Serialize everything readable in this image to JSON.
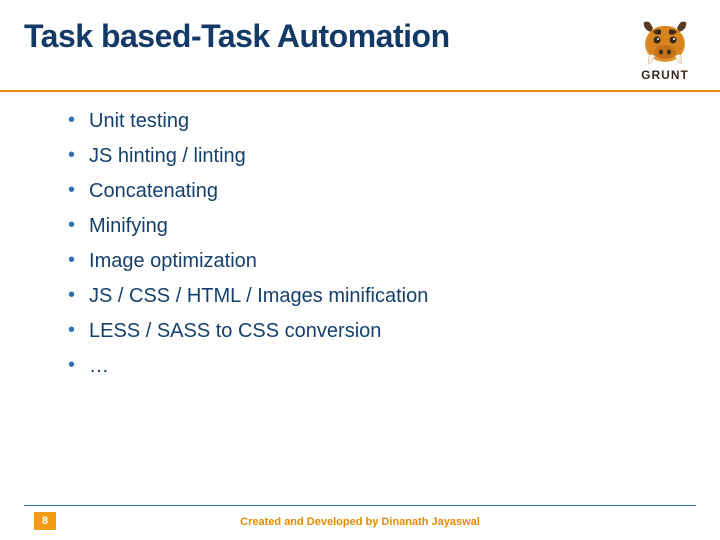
{
  "title": "Task based-Task Automation",
  "logo": {
    "text": "GRUNT"
  },
  "bullets": [
    "Unit testing",
    "JS hinting / linting",
    "Concatenating",
    "Minifying",
    "Image optimization",
    "JS / CSS / HTML / Images minification",
    "LESS / SASS to CSS conversion",
    "…"
  ],
  "page_number": "8",
  "credit": "Created and Developed by Dinanath Jayaswal"
}
